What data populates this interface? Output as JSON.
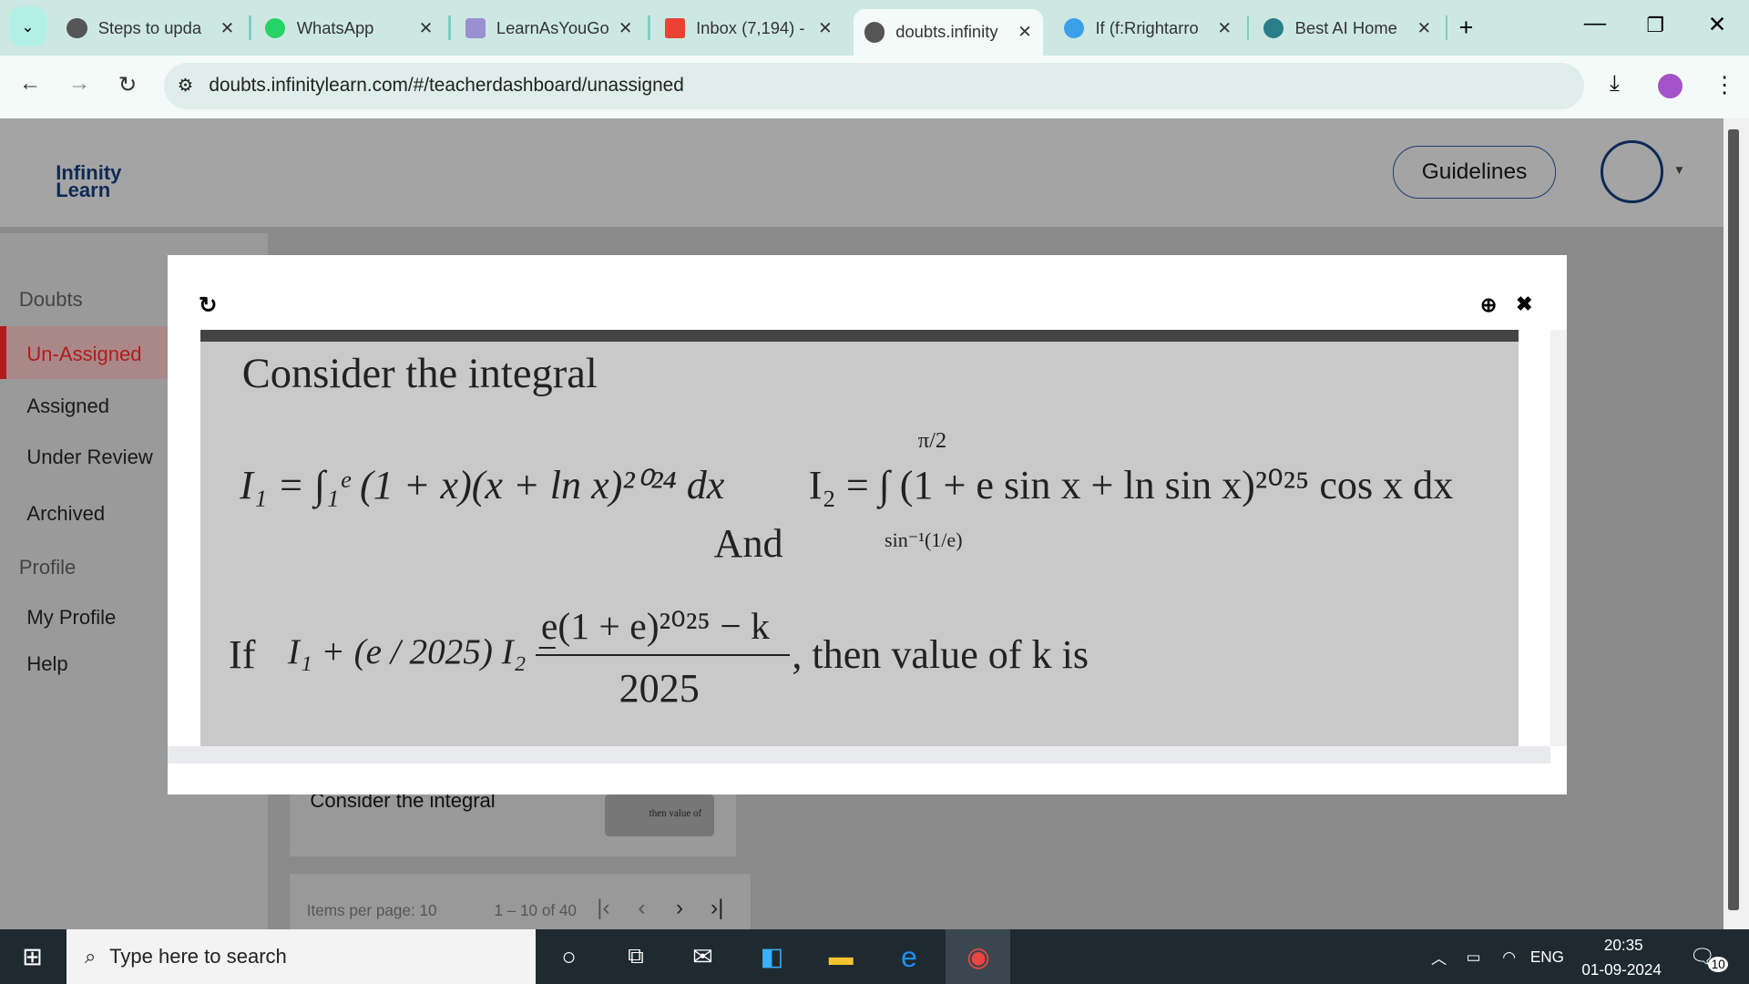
{
  "browser": {
    "tabs": [
      {
        "title": "Steps to upda",
        "icon": "globe-icon"
      },
      {
        "title": "WhatsApp",
        "icon": "whatsapp-icon"
      },
      {
        "title": "LearnAsYouGo",
        "icon": "learnasyougo-icon"
      },
      {
        "title": "Inbox (7,194) -",
        "icon": "gmail-icon"
      },
      {
        "title": "doubts.infinity",
        "icon": "globe-icon",
        "active": true
      },
      {
        "title": "If (f:Rrightarro",
        "icon": "upload-icon"
      },
      {
        "title": "Best AI Home",
        "icon": "ai-icon"
      }
    ],
    "url": "doubts.infinitylearn.com/#/teacherdashboard/unassigned"
  },
  "app": {
    "logo": "Infinity Learn",
    "guidelines": "Guidelines",
    "sidebar": {
      "group1": "Doubts",
      "items": [
        "Un-Assigned",
        "Assigned",
        "Under Review",
        "Archived"
      ],
      "group2": "Profile",
      "items2": [
        "My Profile",
        "Help"
      ]
    },
    "card_title": "Consider the integral",
    "thumb_text": "then value of",
    "pagination": {
      "items_per_page": "Items per page: 10",
      "range": "1 – 10 of 40"
    }
  },
  "modal": {
    "image_text": {
      "heading": "Consider the integral",
      "i1": "I₁ = ∫₁ᵉ (1 + x)(x + ln x)²⁰²⁴ dx",
      "and": "And",
      "i2": "I₂ = ∫ (1 + e sin x + ln sin x)²⁰²⁵ cos x dx",
      "i2_upper": "π/2",
      "i2_lower": "sin⁻¹(1/e)",
      "cond_if": "If",
      "cond_lhs": "I₁ + (e / 2025) I₂ =",
      "cond_num": "e(1 + e)²⁰²⁵ − k",
      "cond_den": "2025",
      "cond_tail": ", then value of k is"
    }
  },
  "taskbar": {
    "search": "Type here to search",
    "lang": "ENG",
    "time": "20:35",
    "date": "01-09-2024",
    "notifications": "10"
  }
}
